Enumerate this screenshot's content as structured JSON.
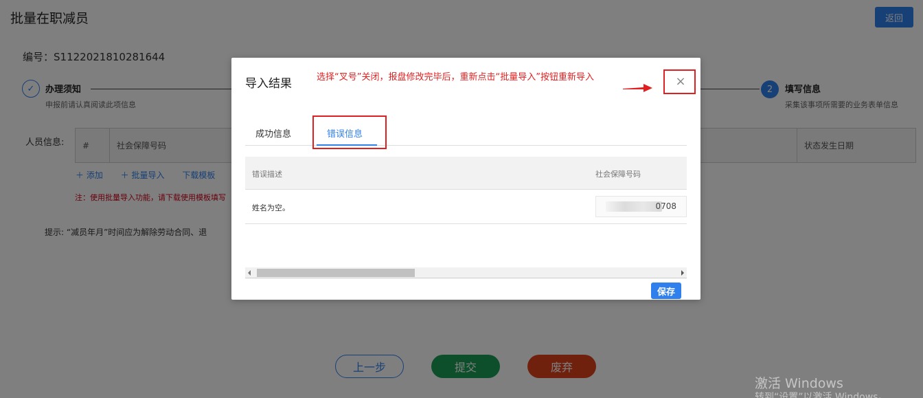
{
  "page": {
    "title": "批量在职减员",
    "back_label": "返回",
    "serial": "编号：S1122021810281644"
  },
  "steps": [
    {
      "number": "✓",
      "title": "办理须知",
      "subtitle": "申报前请认真阅读此项信息"
    },
    {
      "number": "2",
      "title": "填写信息",
      "subtitle": "采集该事项所需要的业务表单信息"
    }
  ],
  "person_table": {
    "label": "人员信息:",
    "columns": [
      "#",
      "社会保障号码",
      "状态发生日期"
    ]
  },
  "actions": {
    "add": "＋ 添加",
    "batch_import": "＋ 批量导入",
    "download_template": "下载模板"
  },
  "note": "注：使用批量导入功能，请下载使用模板填写",
  "hint": "提示:  “减员年月”时间应为解除劳动合同、退",
  "buttons": {
    "prev": "上一步",
    "submit": "提交",
    "discard": "废弃"
  },
  "watermark": {
    "line1": "激活 Windows",
    "line2": "转到“设置”以激活 Windows。"
  },
  "modal": {
    "title": "导入结果",
    "annotation": "选择“叉号”关闭，报盘修改完毕后，重新点击“批量导入”按钮重新导入",
    "close_glyph": "×",
    "tabs": [
      {
        "label": "成功信息",
        "active": false
      },
      {
        "label": "错误信息",
        "active": true
      }
    ],
    "grid": {
      "columns": [
        "错误描述",
        "社会保障号码"
      ],
      "rows": [
        {
          "description": "姓名为空。",
          "ssn_visible": "0708"
        }
      ]
    },
    "save_label": "保存"
  },
  "colors": {
    "accent": "#2f80ed",
    "annotation_red": "#e02020",
    "submit_green": "#1a9e55",
    "discard_red": "#e0431d"
  },
  "icons": [
    "check-icon",
    "close-icon",
    "arrow-right-icon",
    "scroll-left-icon",
    "scroll-right-icon"
  ]
}
